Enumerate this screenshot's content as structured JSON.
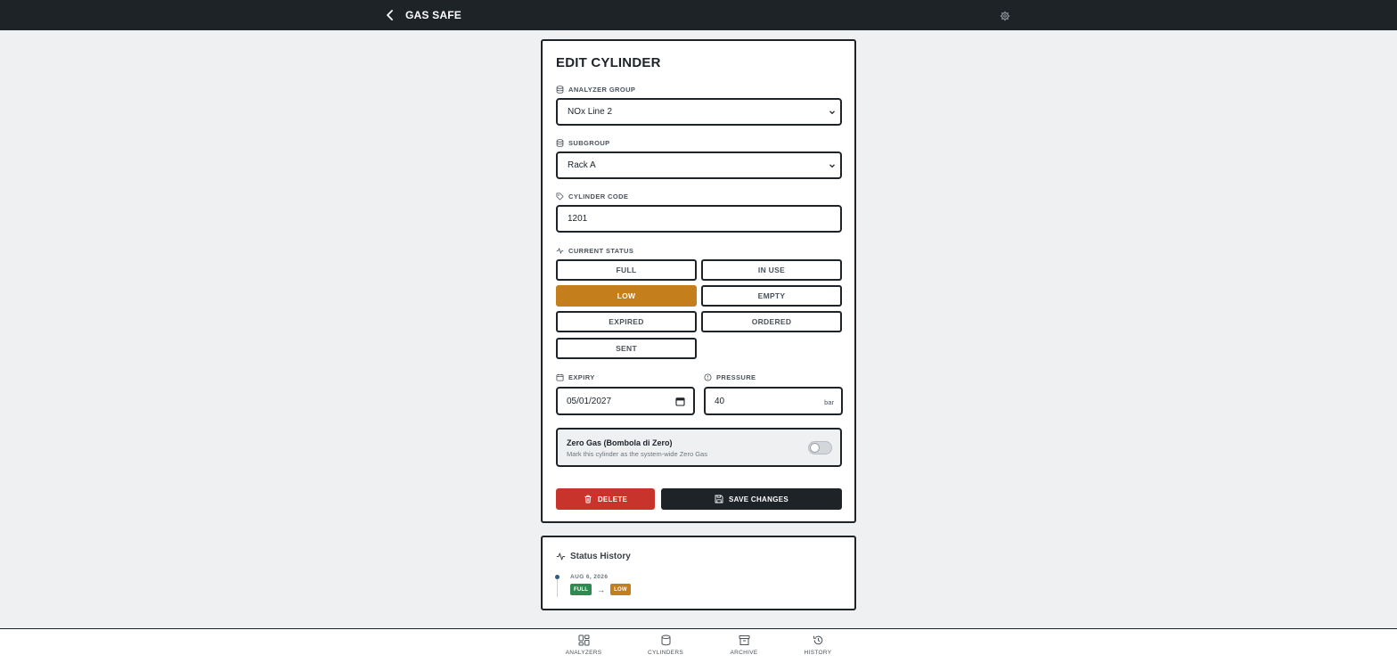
{
  "header": {
    "title": "GAS SAFE"
  },
  "form": {
    "title": "EDIT CYLINDER",
    "analyzer_group": {
      "label": "ANALYZER GROUP",
      "value": "NOx Line 2"
    },
    "subgroup": {
      "label": "SUBGROUP",
      "value": "Rack A"
    },
    "cylinder_code": {
      "label": "CYLINDER CODE",
      "value": "1201"
    },
    "current_status": {
      "label": "CURRENT STATUS",
      "options": [
        "FULL",
        "IN USE",
        "LOW",
        "EMPTY",
        "EXPIRED",
        "ORDERED",
        "SENT"
      ],
      "selected": "LOW"
    },
    "expiry": {
      "label": "EXPIRY",
      "value": "05/01/2027"
    },
    "pressure": {
      "label": "PRESSURE",
      "value": "40",
      "unit": "bar"
    },
    "zero_gas": {
      "title": "Zero Gas (Bombola di Zero)",
      "subtitle": "Mark this cylinder as the system-wide Zero Gas",
      "enabled": false
    },
    "delete_label": "DELETE",
    "save_label": "SAVE CHANGES"
  },
  "history": {
    "title": "Status History",
    "entries": [
      {
        "date": "AUG 6, 2026",
        "from": "FULL",
        "to": "LOW"
      }
    ]
  },
  "bottom_nav": {
    "items": [
      {
        "label": "ANALYZERS",
        "icon": "grid-icon"
      },
      {
        "label": "CYLINDERS",
        "icon": "cylinder-icon"
      },
      {
        "label": "ARCHIVE",
        "icon": "archive-icon"
      },
      {
        "label": "HISTORY",
        "icon": "history-icon"
      }
    ]
  },
  "colors": {
    "dark": "#1e2328",
    "accent_low": "#c47e1b",
    "danger": "#c8342b",
    "success": "#2f8a50",
    "background": "#eef0f2"
  }
}
